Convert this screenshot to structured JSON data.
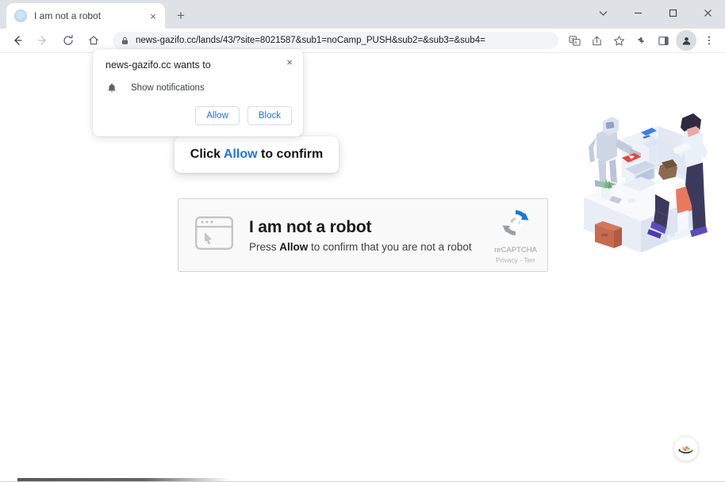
{
  "browser": {
    "tab": {
      "title": "I am not a robot",
      "favicon": "globe-favicon",
      "close": "×"
    },
    "newtab_label": "+",
    "window_controls": {
      "tab_search": "tab-search-chevron",
      "minimize": "—",
      "maximize": "□",
      "close": "✕"
    },
    "nav": {
      "back": "←",
      "forward": "→",
      "reload": "⟳",
      "home": "⌂"
    },
    "omnibox": {
      "lock_icon": "lock-icon",
      "url": "news-gazifo.cc/lands/43/?site=8021587&sub1=noCamp_PUSH&sub2=&sub3=&sub4="
    },
    "toolbar_icons": [
      "translate-icon",
      "share-icon",
      "bookmark-star-icon",
      "extensions-puzzle-icon",
      "side-panel-icon",
      "profile-avatar-icon",
      "three-dot-menu-icon"
    ]
  },
  "permission_popup": {
    "title": "news-gazifo.cc wants to",
    "option_icon": "bell-icon",
    "option_label": "Show notifications",
    "allow_label": "Allow",
    "block_label": "Block",
    "close_label": "×"
  },
  "hint_banner": {
    "prefix": "Click ",
    "accent": "Allow",
    "suffix": " to confirm",
    "accent_color": "#1a73e8"
  },
  "captcha": {
    "icon": "browser-window-cursor-icon",
    "title": "I am not a robot",
    "subtitle_prefix": "Press ",
    "subtitle_bold": "Allow",
    "subtitle_suffix": " to confirm that you are not a robot",
    "brand_name": "reCAPTCHA",
    "brand_links": "Privacy - Terr",
    "logo": "recaptcha-logo",
    "border_color": "#d3d3d3",
    "background_color": "#f9f9f9"
  },
  "illustration": {
    "name": "office-robot-workers-illustration"
  },
  "floating_widget": {
    "name": "food-dish-widget-icon"
  }
}
